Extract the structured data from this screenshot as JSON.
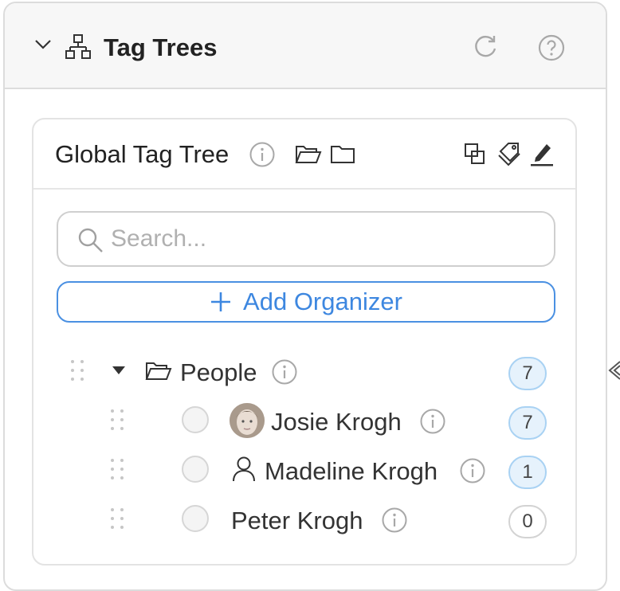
{
  "header": {
    "title": "Tag Trees",
    "icons": [
      "chevron-down-icon",
      "sitemap-icon",
      "refresh-icon",
      "help-icon"
    ]
  },
  "card": {
    "title": "Global Tag Tree",
    "icons": [
      "info-icon",
      "folder-open-icon",
      "folder-icon",
      "clone-icon",
      "tags-icon",
      "pencil-icon"
    ]
  },
  "search": {
    "placeholder": "Search..."
  },
  "add_organizer": {
    "label": "Add Organizer"
  },
  "tree": {
    "root": {
      "label": "People",
      "count": "7",
      "expanded": true
    },
    "children": [
      {
        "label": "Josie Krogh",
        "count": "7",
        "kind": "avatar"
      },
      {
        "label": "Madeline Krogh",
        "count": "1",
        "kind": "person-icon"
      },
      {
        "label": "Peter Krogh",
        "count": "0",
        "kind": "none"
      }
    ]
  },
  "colors": {
    "accent": "#3d87e0",
    "badge_bg": "#e6f2fc",
    "badge_border": "#a9d2f3"
  }
}
